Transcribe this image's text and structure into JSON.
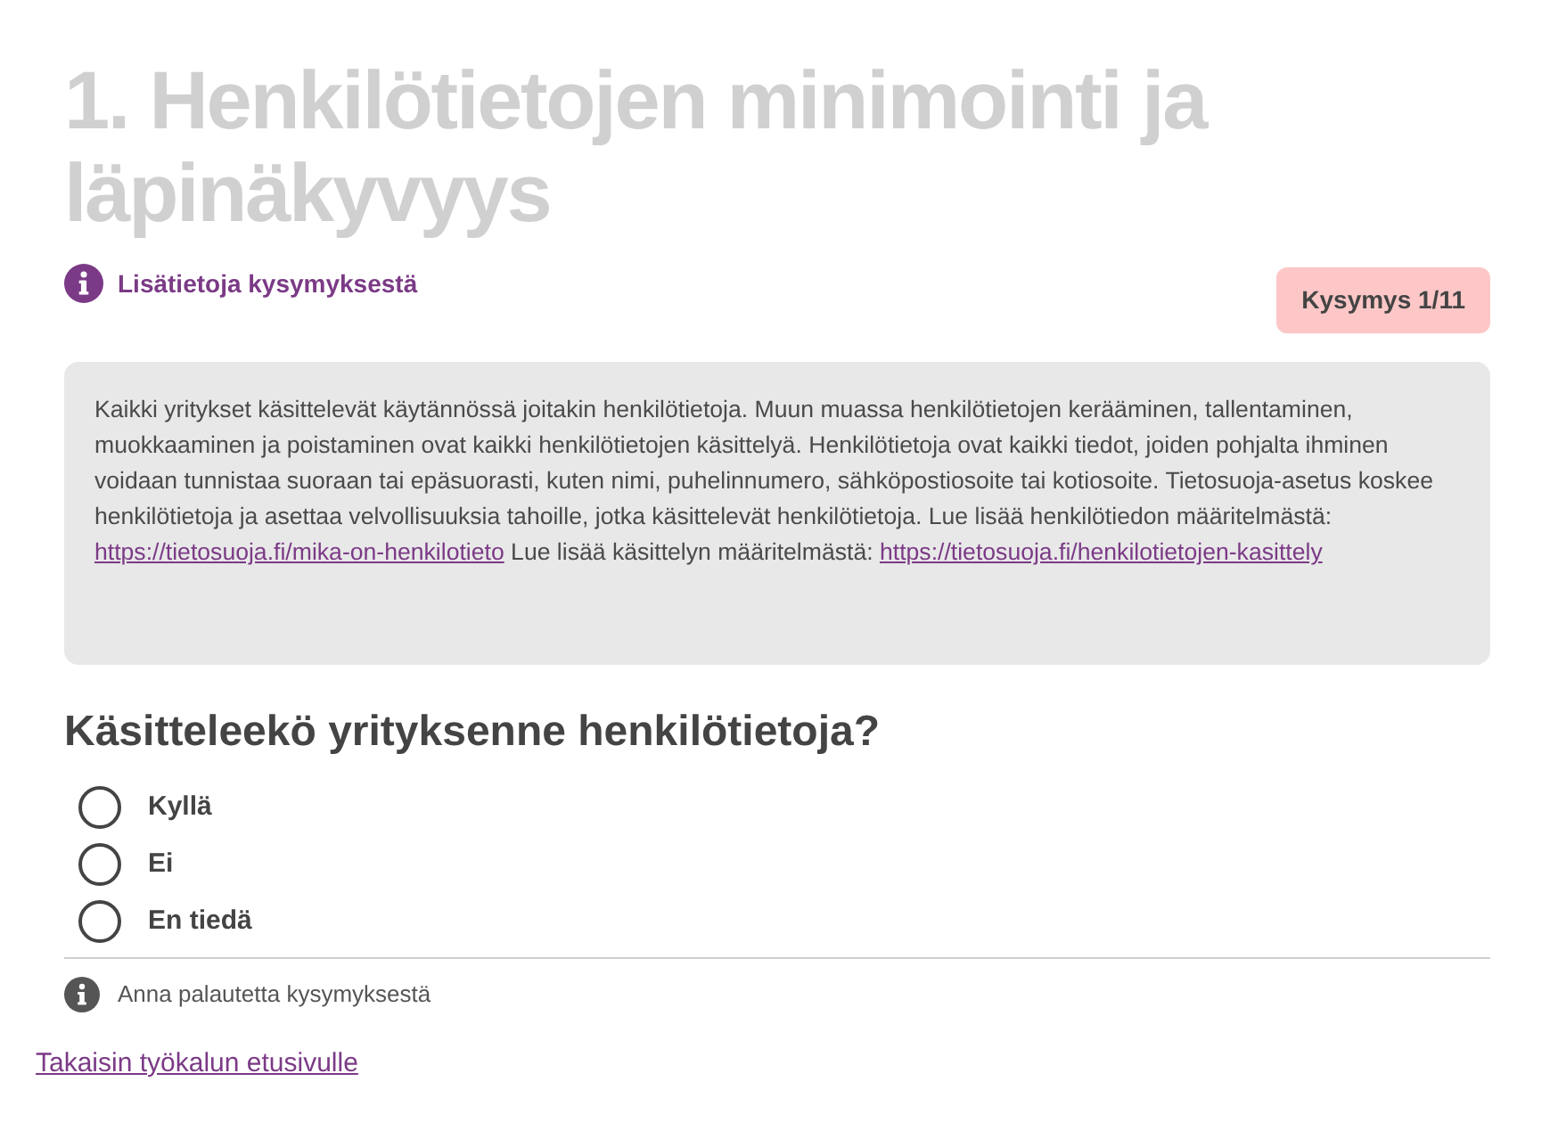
{
  "title": "1. Henkilötietojen minimointi ja läpinäkyvyys",
  "info_link": "Lisätietoja kysymyksestä",
  "counter": "Kysymys 1/11",
  "description": [
    {
      "kind": "text",
      "text": "Kaikki yritykset käsittelevät käytännössä joitakin henkilötietoja. Muun muassa henkilötietojen kerääminen, tallentaminen, muokkaaminen ja poistaminen ovat kaikki henkilötietojen käsittelyä. Henkilötietoja ovat kaikki tiedot, joiden pohjalta ihminen voidaan tunnistaa suoraan tai epäsuorasti, kuten nimi, puhelinnumero, sähköpostiosoite tai kotiosoite. Tietosuoja-asetus koskee henkilötietoja ja asettaa velvollisuuksia tahoille, jotka käsittelevät henkilötietoja. Lue lisää henkilötiedon määritelmästä: "
    },
    {
      "kind": "link",
      "text": "https://tietosuoja.fi/mika-on-henkilotieto"
    },
    {
      "kind": "text",
      "text": " Lue lisää käsittelyn määritelmästä: "
    },
    {
      "kind": "link",
      "text": "https://tietosuoja.fi/henkilotietojen-kasittely"
    }
  ],
  "question": "Käsitteleekö yrityksenne henkilötietoja?",
  "options": [
    {
      "label": "Kyllä",
      "selected": false
    },
    {
      "label": "Ei",
      "selected": false
    },
    {
      "label": "En tiedä",
      "selected": false
    }
  ],
  "feedback": "Anna palautetta kysymyksestä",
  "back_link": "Takaisin työkalun etusivulle"
}
